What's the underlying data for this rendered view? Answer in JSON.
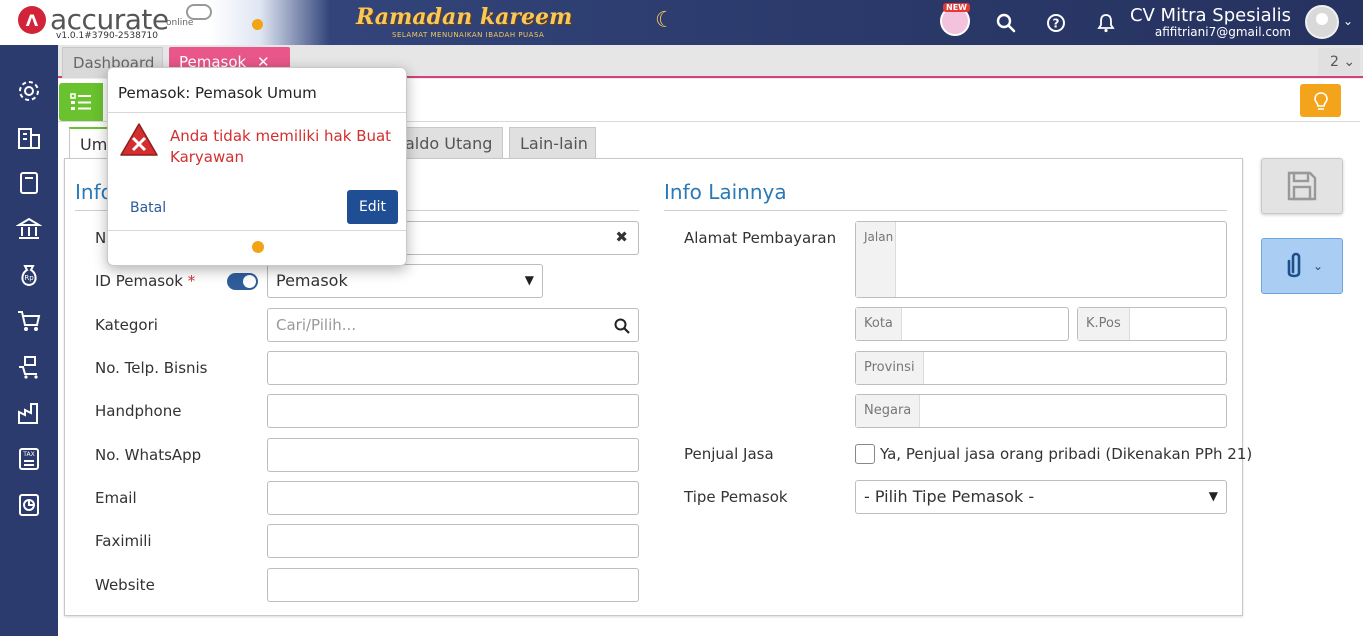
{
  "header": {
    "logo_text": "accurate",
    "logo_online": "online",
    "version": "v1.0.1#3790-2538710",
    "banner_title": "Ramadan kareem",
    "banner_subtitle": "SELAMAT MENUNAIKAN IBADAH PUASA",
    "new_badge": "NEW",
    "company_name": "CV Mitra Spesialis",
    "user_email": "afifitriani7@gmail.com"
  },
  "tabs": {
    "dashboard": "Dashboard",
    "pemasok": "Pemasok",
    "count": "2 ⌄"
  },
  "inner_tabs": {
    "umum": "Um",
    "saldo_utang": "aldo Utang",
    "lain_lain": "Lain-lain"
  },
  "left_section": {
    "title": "Info",
    "name_label": "N",
    "id_label": "ID Pemasok",
    "id_required": "*",
    "id_value": "Pemasok",
    "kategori_label": "Kategori",
    "kategori_placeholder": "Cari/Pilih...",
    "telp_label": "No. Telp. Bisnis",
    "handphone_label": "Handphone",
    "whatsapp_label": "No. WhatsApp",
    "email_label": "Email",
    "faximili_label": "Faximili",
    "website_label": "Website"
  },
  "right_section": {
    "title": "Info Lainnya",
    "alamat_label": "Alamat Pembayaran",
    "jalan_addon": "Jalan",
    "kota_addon": "Kota",
    "kpos_addon": "K.Pos",
    "provinsi_addon": "Provinsi",
    "negara_addon": "Negara",
    "penjual_label": "Penjual Jasa",
    "penjual_checkbox_text": "Ya, Penjual jasa orang pribadi (Dikenakan PPh 21)",
    "tipe_label": "Tipe Pemasok",
    "tipe_value": "- Pilih Tipe Pemasok -"
  },
  "popover": {
    "title": "Pemasok: Pemasok Umum",
    "message": "Anda tidak memiliki hak Buat Karyawan",
    "cancel": "Batal",
    "edit": "Edit"
  },
  "colors": {
    "sidebar": "#2c3b6e",
    "accent_pink": "#e8568a",
    "accent_green": "#69c22e",
    "accent_orange": "#f4a41b",
    "link_blue": "#2a7ab8",
    "error_red": "#d32f2f"
  },
  "sidebar_icons": [
    "gear-icon",
    "building-icon",
    "book-icon",
    "bank-icon",
    "money-bag-icon",
    "cart-icon",
    "cart-stock-icon",
    "factory-icon",
    "tax-icon",
    "report-icon"
  ]
}
